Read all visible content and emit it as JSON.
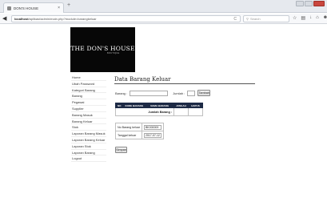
{
  "browser": {
    "tab_title": "DON'S HOUSE",
    "tab_close": "×",
    "new_tab": "+",
    "url_host": "localhost",
    "url_path": "/aplikasi/admin/main.php?module=barangkeluar",
    "search_placeholder": "Search",
    "nav_back": "◀",
    "reload": "C",
    "toolbar_icons": [
      "☆",
      "▤",
      "↓",
      "⌂",
      "☻",
      "≡"
    ]
  },
  "brand": {
    "logo_text": "THE DON'S HOUSE",
    "logo_sub": "BOUTIQUE"
  },
  "sidebar": {
    "items": [
      {
        "label": "Home"
      },
      {
        "label": "Ubah Password"
      },
      {
        "label": "Kategori Barang"
      },
      {
        "label": "Barang"
      },
      {
        "label": "Pegawai"
      },
      {
        "label": "Supplier"
      },
      {
        "label": "Barang Masuk"
      },
      {
        "label": "Barang Keluar"
      },
      {
        "label": "Stok"
      },
      {
        "label": "Laporan Barang Masuk"
      },
      {
        "label": "Laporan Barang Keluar"
      },
      {
        "label": "Laporan Stok"
      },
      {
        "label": "Laporan Barang"
      },
      {
        "label": "Logout"
      }
    ]
  },
  "main": {
    "title": "Data Barang Keluar",
    "barang_label": "Barang :",
    "jumlah_label": "Jumlah :",
    "tambah_label": "Tambah",
    "table": {
      "headers": [
        "NO",
        "KODE BARANG",
        "NAMA BARANG",
        "JUMLAH",
        "HAPUS"
      ],
      "total_label": "Jumlah Barang :"
    },
    "no_barang_keluar_label": "No Barang keluar",
    "no_barang_keluar_value": "BK000009",
    "tanggal_keluar_label": "Tanggal keluar",
    "tanggal_keluar_value": "2017-07-12",
    "simpan_label": "Simpan"
  }
}
